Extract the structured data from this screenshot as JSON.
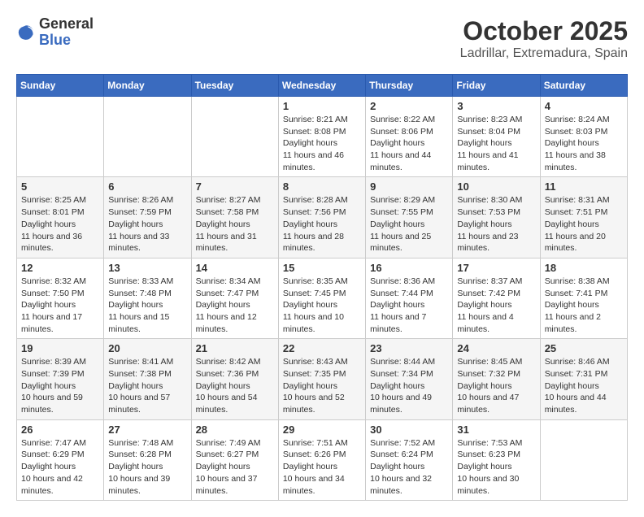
{
  "header": {
    "logo_general": "General",
    "logo_blue": "Blue",
    "month_title": "October 2025",
    "location": "Ladrillar, Extremadura, Spain"
  },
  "weekdays": [
    "Sunday",
    "Monday",
    "Tuesday",
    "Wednesday",
    "Thursday",
    "Friday",
    "Saturday"
  ],
  "weeks": [
    [
      {
        "day": "",
        "sunrise": "",
        "sunset": "",
        "daylight": ""
      },
      {
        "day": "",
        "sunrise": "",
        "sunset": "",
        "daylight": ""
      },
      {
        "day": "",
        "sunrise": "",
        "sunset": "",
        "daylight": ""
      },
      {
        "day": "1",
        "sunrise": "8:21 AM",
        "sunset": "8:08 PM",
        "daylight": "11 hours and 46 minutes."
      },
      {
        "day": "2",
        "sunrise": "8:22 AM",
        "sunset": "8:06 PM",
        "daylight": "11 hours and 44 minutes."
      },
      {
        "day": "3",
        "sunrise": "8:23 AM",
        "sunset": "8:04 PM",
        "daylight": "11 hours and 41 minutes."
      },
      {
        "day": "4",
        "sunrise": "8:24 AM",
        "sunset": "8:03 PM",
        "daylight": "11 hours and 38 minutes."
      }
    ],
    [
      {
        "day": "5",
        "sunrise": "8:25 AM",
        "sunset": "8:01 PM",
        "daylight": "11 hours and 36 minutes."
      },
      {
        "day": "6",
        "sunrise": "8:26 AM",
        "sunset": "7:59 PM",
        "daylight": "11 hours and 33 minutes."
      },
      {
        "day": "7",
        "sunrise": "8:27 AM",
        "sunset": "7:58 PM",
        "daylight": "11 hours and 31 minutes."
      },
      {
        "day": "8",
        "sunrise": "8:28 AM",
        "sunset": "7:56 PM",
        "daylight": "11 hours and 28 minutes."
      },
      {
        "day": "9",
        "sunrise": "8:29 AM",
        "sunset": "7:55 PM",
        "daylight": "11 hours and 25 minutes."
      },
      {
        "day": "10",
        "sunrise": "8:30 AM",
        "sunset": "7:53 PM",
        "daylight": "11 hours and 23 minutes."
      },
      {
        "day": "11",
        "sunrise": "8:31 AM",
        "sunset": "7:51 PM",
        "daylight": "11 hours and 20 minutes."
      }
    ],
    [
      {
        "day": "12",
        "sunrise": "8:32 AM",
        "sunset": "7:50 PM",
        "daylight": "11 hours and 17 minutes."
      },
      {
        "day": "13",
        "sunrise": "8:33 AM",
        "sunset": "7:48 PM",
        "daylight": "11 hours and 15 minutes."
      },
      {
        "day": "14",
        "sunrise": "8:34 AM",
        "sunset": "7:47 PM",
        "daylight": "11 hours and 12 minutes."
      },
      {
        "day": "15",
        "sunrise": "8:35 AM",
        "sunset": "7:45 PM",
        "daylight": "11 hours and 10 minutes."
      },
      {
        "day": "16",
        "sunrise": "8:36 AM",
        "sunset": "7:44 PM",
        "daylight": "11 hours and 7 minutes."
      },
      {
        "day": "17",
        "sunrise": "8:37 AM",
        "sunset": "7:42 PM",
        "daylight": "11 hours and 4 minutes."
      },
      {
        "day": "18",
        "sunrise": "8:38 AM",
        "sunset": "7:41 PM",
        "daylight": "11 hours and 2 minutes."
      }
    ],
    [
      {
        "day": "19",
        "sunrise": "8:39 AM",
        "sunset": "7:39 PM",
        "daylight": "10 hours and 59 minutes."
      },
      {
        "day": "20",
        "sunrise": "8:41 AM",
        "sunset": "7:38 PM",
        "daylight": "10 hours and 57 minutes."
      },
      {
        "day": "21",
        "sunrise": "8:42 AM",
        "sunset": "7:36 PM",
        "daylight": "10 hours and 54 minutes."
      },
      {
        "day": "22",
        "sunrise": "8:43 AM",
        "sunset": "7:35 PM",
        "daylight": "10 hours and 52 minutes."
      },
      {
        "day": "23",
        "sunrise": "8:44 AM",
        "sunset": "7:34 PM",
        "daylight": "10 hours and 49 minutes."
      },
      {
        "day": "24",
        "sunrise": "8:45 AM",
        "sunset": "7:32 PM",
        "daylight": "10 hours and 47 minutes."
      },
      {
        "day": "25",
        "sunrise": "8:46 AM",
        "sunset": "7:31 PM",
        "daylight": "10 hours and 44 minutes."
      }
    ],
    [
      {
        "day": "26",
        "sunrise": "7:47 AM",
        "sunset": "6:29 PM",
        "daylight": "10 hours and 42 minutes."
      },
      {
        "day": "27",
        "sunrise": "7:48 AM",
        "sunset": "6:28 PM",
        "daylight": "10 hours and 39 minutes."
      },
      {
        "day": "28",
        "sunrise": "7:49 AM",
        "sunset": "6:27 PM",
        "daylight": "10 hours and 37 minutes."
      },
      {
        "day": "29",
        "sunrise": "7:51 AM",
        "sunset": "6:26 PM",
        "daylight": "10 hours and 34 minutes."
      },
      {
        "day": "30",
        "sunrise": "7:52 AM",
        "sunset": "6:24 PM",
        "daylight": "10 hours and 32 minutes."
      },
      {
        "day": "31",
        "sunrise": "7:53 AM",
        "sunset": "6:23 PM",
        "daylight": "10 hours and 30 minutes."
      },
      {
        "day": "",
        "sunrise": "",
        "sunset": "",
        "daylight": ""
      }
    ]
  ]
}
